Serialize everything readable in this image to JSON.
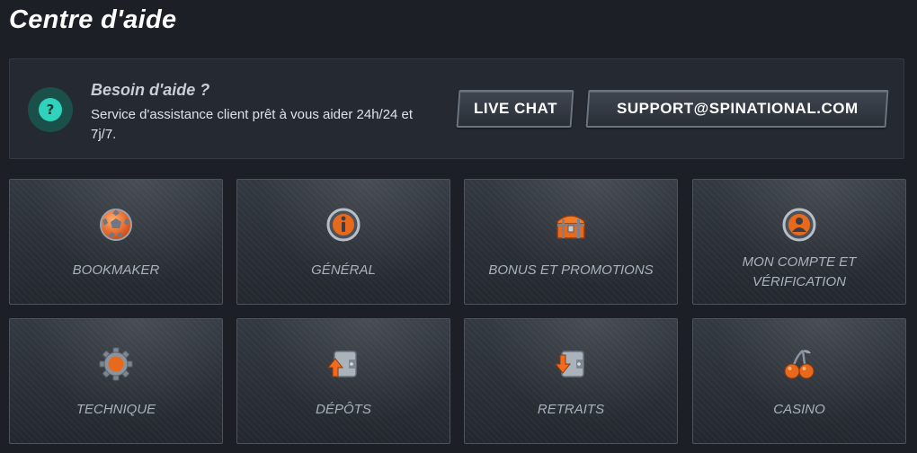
{
  "page": {
    "title": "Centre d'aide"
  },
  "help": {
    "title": "Besoin d'aide ?",
    "description": "Service d'assistance client prêt à vous aider 24h/24 et 7j/7.",
    "icon": "question-icon"
  },
  "actions": {
    "live_chat": "LIVE CHAT",
    "email": "SUPPORT@SPINATIONAL.COM"
  },
  "categories": [
    {
      "label": "BOOKMAKER",
      "icon": "soccer-ball-icon"
    },
    {
      "label": "GÉNÉRAL",
      "icon": "info-icon"
    },
    {
      "label": "BONUS ET PROMOTIONS",
      "icon": "treasure-chest-icon"
    },
    {
      "label": "MON COMPTE ET VÉRIFICATION",
      "icon": "user-account-icon"
    },
    {
      "label": "TECHNIQUE",
      "icon": "gear-icon"
    },
    {
      "label": "DÉPÔTS",
      "icon": "deposit-wallet-icon"
    },
    {
      "label": "RETRAITS",
      "icon": "withdraw-wallet-icon"
    },
    {
      "label": "CASINO",
      "icon": "cherries-icon"
    }
  ],
  "colors": {
    "accent": "#f26a1b",
    "help_icon": "#2fd3bc",
    "background": "#1c1f25"
  }
}
